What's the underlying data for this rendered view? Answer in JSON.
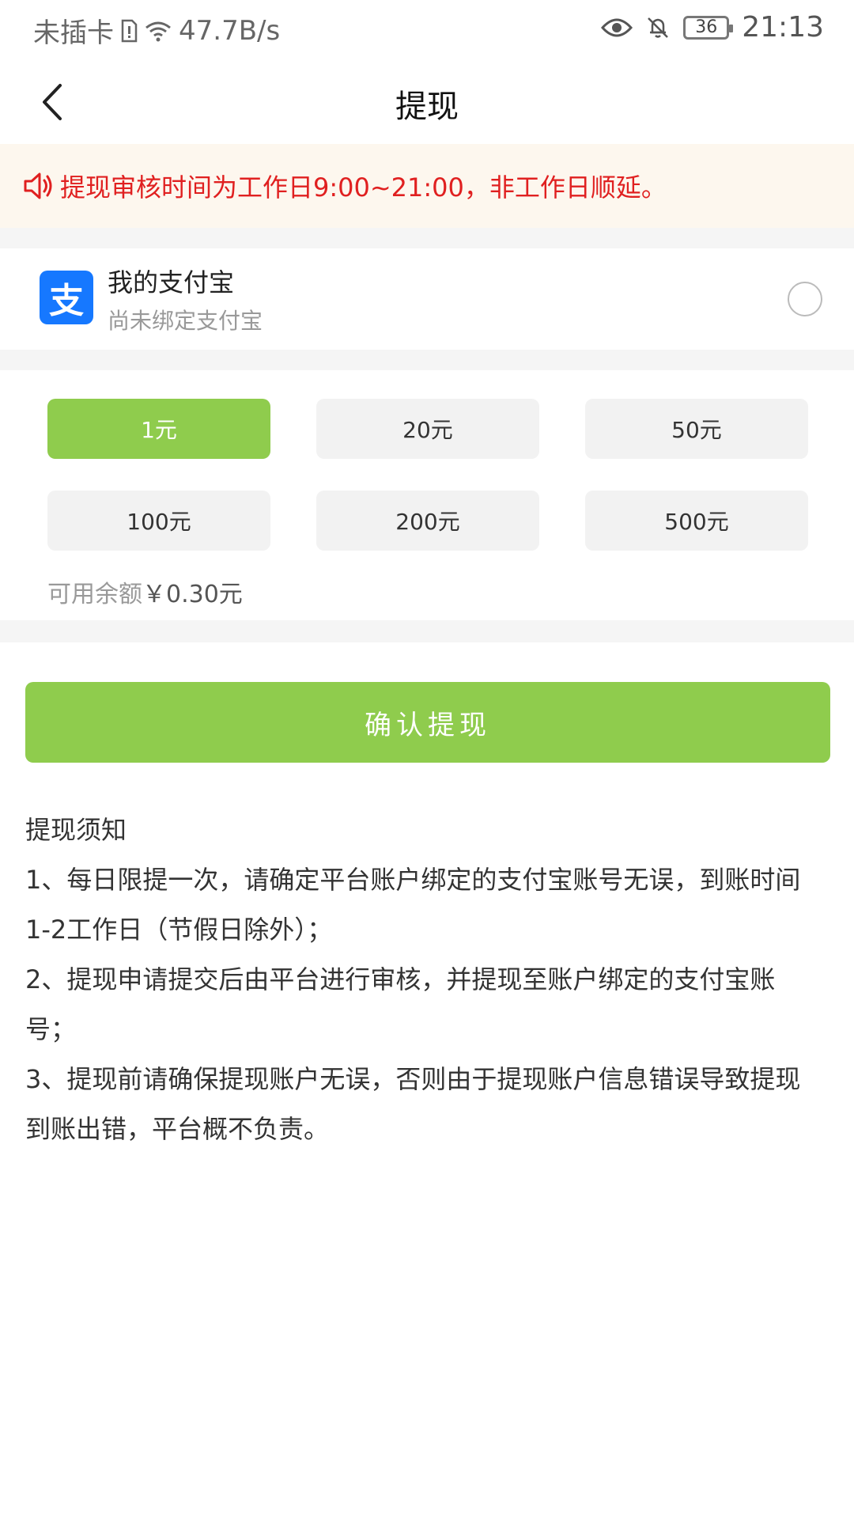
{
  "status_bar": {
    "carrier": "未插卡",
    "net_speed": "47.7B/s",
    "battery": "36",
    "time": "21:13"
  },
  "nav": {
    "title": "提现"
  },
  "notice": {
    "text": "提现审核时间为工作日9:00~21:00，非工作日顺延。"
  },
  "alipay": {
    "name": "我的支付宝",
    "subtitle": "尚未绑定支付宝",
    "logo_glyph": "支"
  },
  "amounts": {
    "options": [
      "1元",
      "20元",
      "50元",
      "100元",
      "200元",
      "500元"
    ],
    "selected": "1元",
    "balance_label": "可用余额",
    "balance_value": "￥0.30元"
  },
  "confirm_label": "确认提现",
  "notes": {
    "title": "提现须知",
    "items": [
      "1、每日限提一次，请确定平台账户绑定的支付宝账号无误，到账时间1-2工作日（节假日除外）；",
      "2、提现申请提交后由平台进行审核，并提现至账户绑定的支付宝账号；",
      "3、提现前请确保提现账户无误，否则由于提现账户信息错误导致提现到账出错，平台概不负责。"
    ]
  },
  "colors": {
    "accent_green": "#8fcc4d",
    "notice_red": "#e02020",
    "alipay_blue": "#1678ff"
  }
}
